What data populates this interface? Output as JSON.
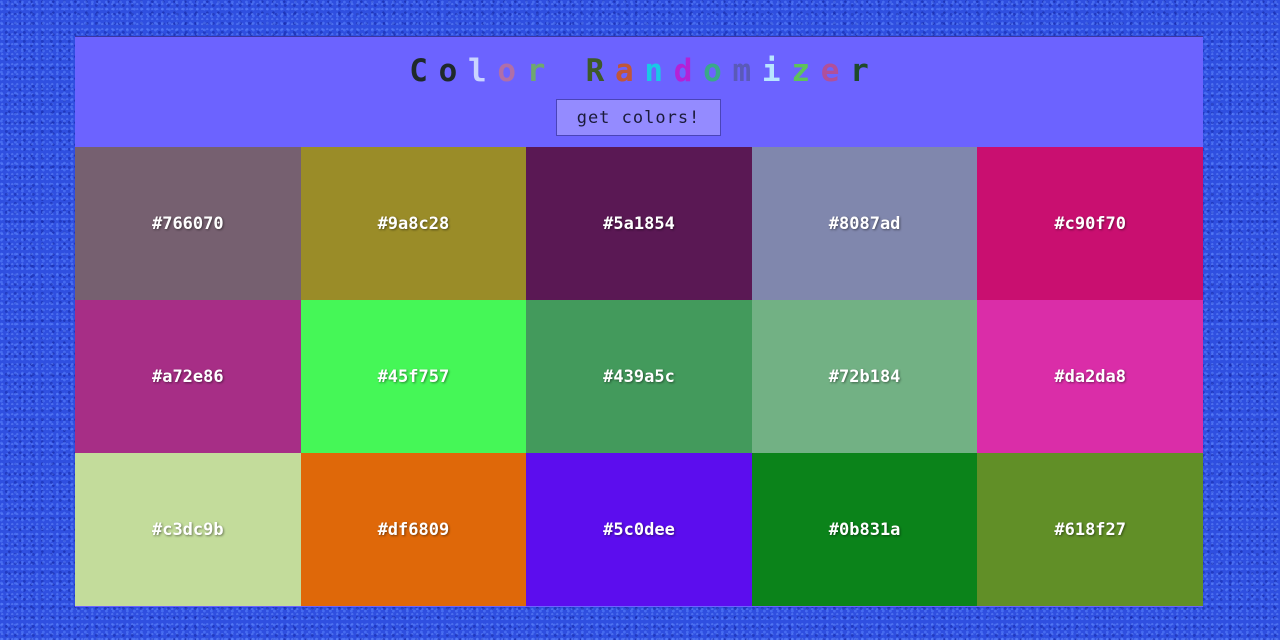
{
  "app": {
    "title_letters": [
      {
        "char": "C",
        "color": "#1f2a2a"
      },
      {
        "char": "o",
        "color": "#1f2a2a"
      },
      {
        "char": "l",
        "color": "#c9d4ff"
      },
      {
        "char": "o",
        "color": "#b06fa8"
      },
      {
        "char": "r",
        "color": "#6fa86f"
      },
      {
        "char": " ",
        "color": "#000000"
      },
      {
        "char": "R",
        "color": "#3e5a2a"
      },
      {
        "char": "a",
        "color": "#c0563a"
      },
      {
        "char": "n",
        "color": "#19c9e6"
      },
      {
        "char": "d",
        "color": "#b322d6"
      },
      {
        "char": "o",
        "color": "#3aa88a"
      },
      {
        "char": "m",
        "color": "#5a5ab8"
      },
      {
        "char": "i",
        "color": "#b8e6ff"
      },
      {
        "char": "z",
        "color": "#5ec25a"
      },
      {
        "char": "e",
        "color": "#b0509a"
      },
      {
        "char": "r",
        "color": "#1f4a2a"
      }
    ],
    "button_label": "get colors!"
  },
  "swatches": [
    {
      "hex": "#766070"
    },
    {
      "hex": "#9a8c28"
    },
    {
      "hex": "#5a1854"
    },
    {
      "hex": "#8087ad"
    },
    {
      "hex": "#c90f70"
    },
    {
      "hex": "#a72e86"
    },
    {
      "hex": "#45f757"
    },
    {
      "hex": "#439a5c"
    },
    {
      "hex": "#72b184"
    },
    {
      "hex": "#da2da8"
    },
    {
      "hex": "#c3dc9b"
    },
    {
      "hex": "#df6809"
    },
    {
      "hex": "#5c0dee"
    },
    {
      "hex": "#0b831a"
    },
    {
      "hex": "#618f27"
    }
  ]
}
